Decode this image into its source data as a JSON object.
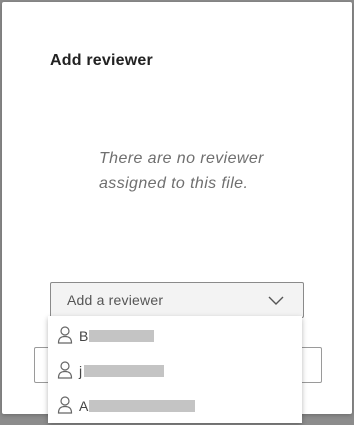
{
  "dialog": {
    "title": "Add reviewer",
    "empty_message": "There are no reviewer assigned to this file."
  },
  "reviewer_select": {
    "placeholder": "Add a reviewer",
    "icon": "chevron-down-icon",
    "options": [
      {
        "initial": "B",
        "icon": "person-icon"
      },
      {
        "initial": "j",
        "icon": "person-icon"
      },
      {
        "initial": "A",
        "icon": "person-icon"
      }
    ]
  },
  "colors": {
    "overlay": "#8c8c8c",
    "dialog_bg": "#ffffff",
    "select_bg": "#f3f3f3",
    "redaction": "#c4c4c4"
  }
}
